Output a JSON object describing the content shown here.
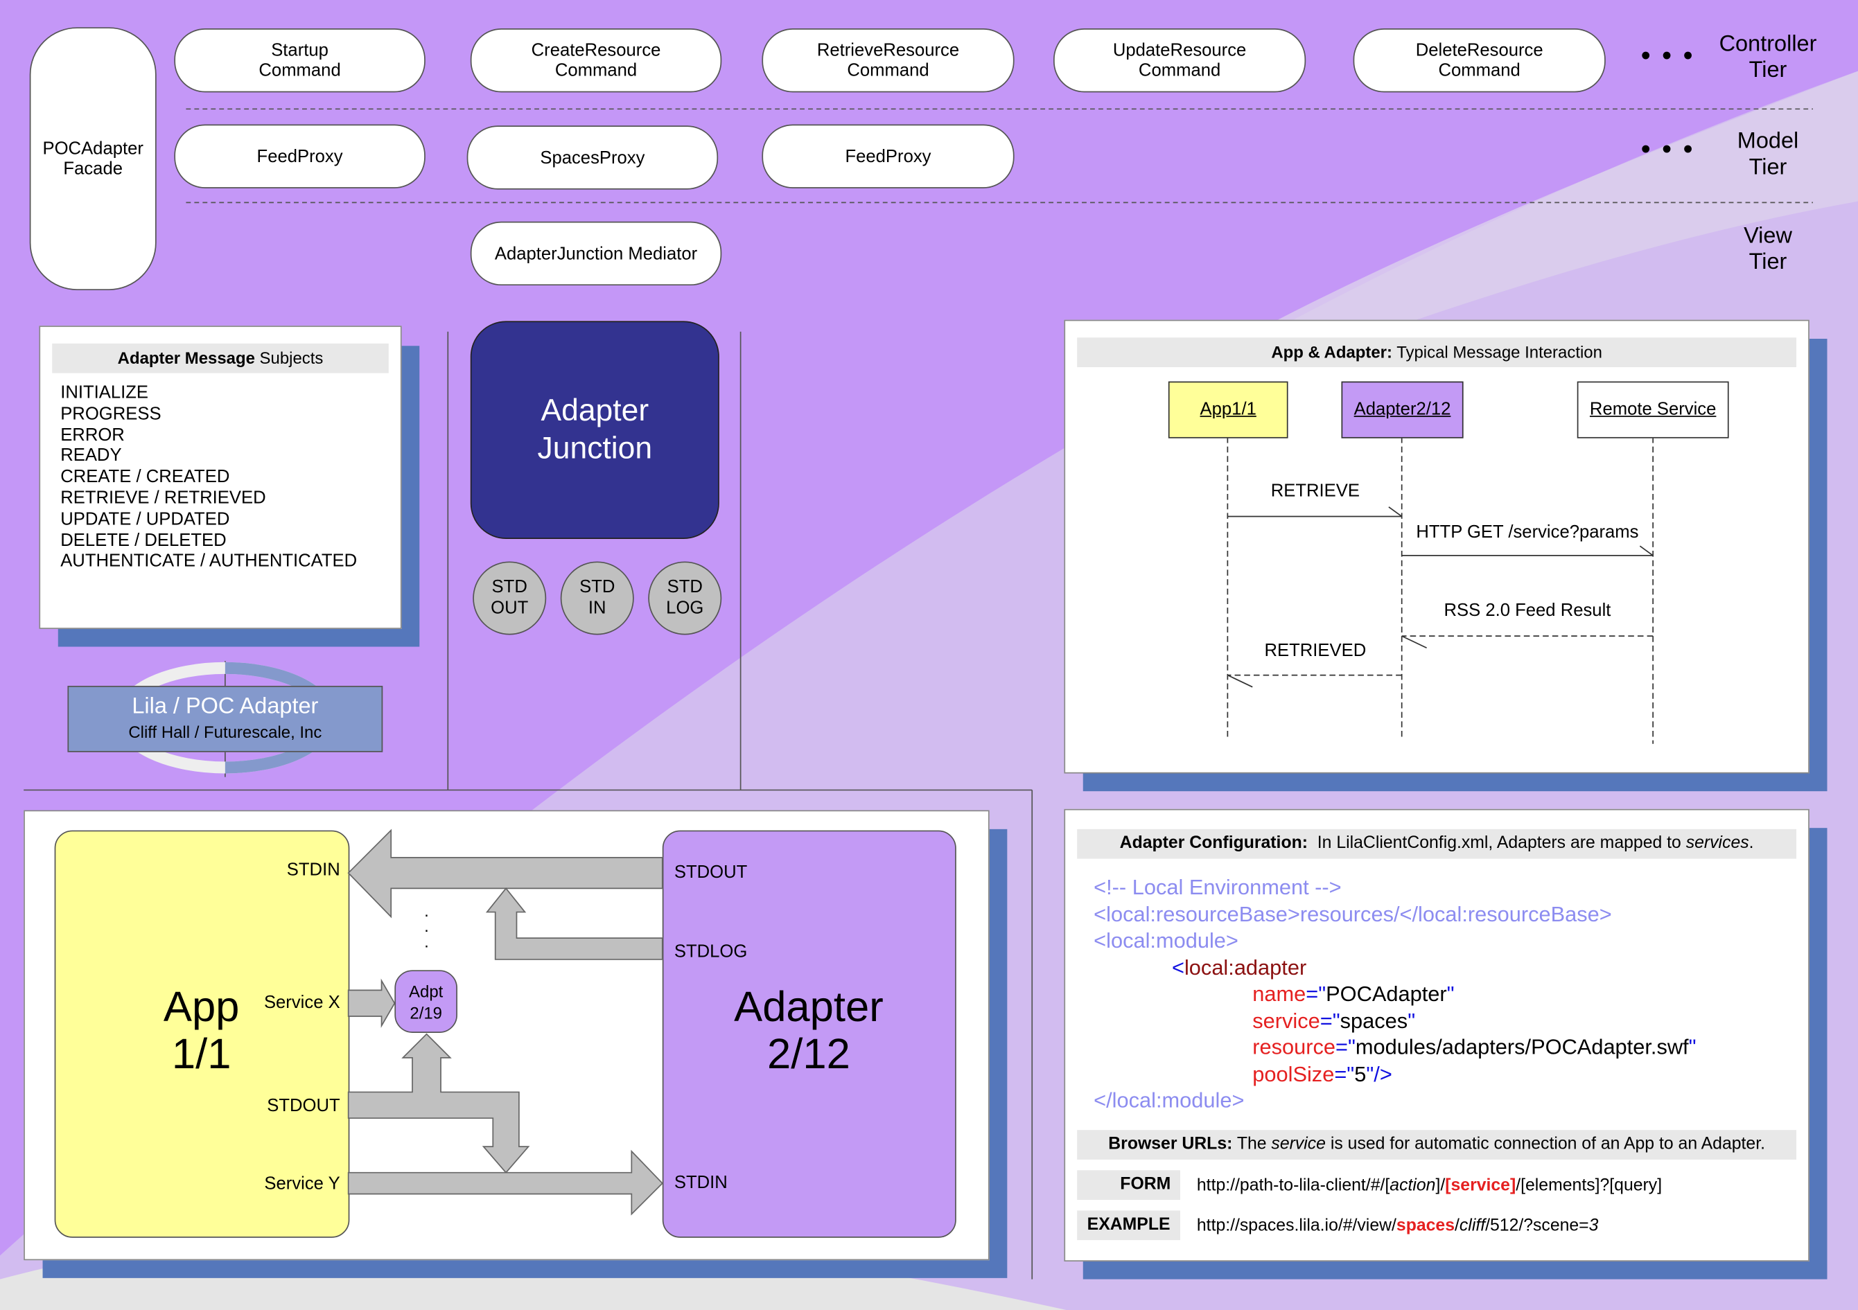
{
  "colors": {
    "background": "#c497f7",
    "junction": "#333390",
    "app": "#ffff99",
    "adapter": "#c39af5",
    "shadow": "#5577bb",
    "logo": "#8499cc"
  },
  "facade": "POCAdapter\nFacade",
  "tiers": {
    "controller": "Controller\nTier",
    "model": "Model\nTier",
    "view": "View\nTier",
    "more": "• • •"
  },
  "controller_commands": [
    "Startup\nCommand",
    "CreateResource\nCommand",
    "RetrieveResource\nCommand",
    "UpdateResource\nCommand",
    "DeleteResource\nCommand"
  ],
  "model_proxies": [
    "FeedProxy",
    "SpacesProxy",
    "FeedProxy"
  ],
  "view_mediators": [
    "AdapterJunction Mediator"
  ],
  "subjects": {
    "title_bold": "Adapter Message",
    "title_rest": " Subjects",
    "items": [
      "INITIALIZE",
      "PROGRESS",
      "ERROR",
      "READY",
      "CREATE / CREATED",
      "RETRIEVE / RETRIEVED",
      "UPDATE / UPDATED",
      "DELETE / DELETED",
      "AUTHENTICATE / AUTHENTICATED"
    ]
  },
  "logo": {
    "title": "Lila / POC Adapter",
    "subtitle": "Cliff Hall / Futurescale, Inc"
  },
  "junction": {
    "title": "Adapter\nJunction",
    "pipes": [
      "STD\nOUT",
      "STD\nIN",
      "STD\nLOG"
    ]
  },
  "sequence": {
    "title_bold": "App & Adapter:",
    "title_rest": " Typical Message Interaction",
    "participants": [
      "App1/1",
      "Adapter2/12",
      "Remote Service"
    ],
    "messages": [
      "RETRIEVE",
      "HTTP GET /service?params",
      "RSS 2.0 Feed Result",
      "RETRIEVED"
    ]
  },
  "pipes_diagram": {
    "app": "App\n1/1",
    "adapter": "Adapter\n2/12",
    "app_ports": [
      "STDIN",
      "Service X",
      "STDOUT",
      "Service Y"
    ],
    "adapter_ports": [
      "STDOUT",
      "STDLOG",
      "STDIN"
    ],
    "mini_adapter": "Adpt\n2/19",
    "ellipsis": "·\n·\n·"
  },
  "config": {
    "title_bold": "Adapter Configuration:",
    "title_rest": "  In LilaClientConfig.xml, Adapters are mapped to ",
    "title_em": "services",
    "title_end": ".",
    "comment": "<!-- Local Environment -->",
    "resource_base": "<local:resourceBase>resources/</local:resourceBase>",
    "module_open": "<local:module>",
    "adapter_lt": "<",
    "adapter_tag": "local:adapter",
    "attrs": [
      {
        "name": "name",
        "value": "POCAdapter"
      },
      {
        "name": "service",
        "value": "spaces"
      },
      {
        "name": "resource",
        "value": "modules/adapters/POCAdapter.swf"
      },
      {
        "name": "poolSize",
        "value": "5"
      }
    ],
    "eq": "=\"",
    "q": "\"",
    "close": "/>",
    "module_close": "</local:module>",
    "urls_bold": "Browser URLs:",
    "urls_rest1": " The ",
    "urls_em": "service",
    "urls_rest2": " is used for automatic connection of an App to an Adapter.",
    "form_label": "FORM",
    "form_a": "http://path-to-lila-client/#/[",
    "form_action": "action",
    "form_b": "]/",
    "form_service": "[service]",
    "form_c": "/[elements]?[query]",
    "example_label": "EXAMPLE",
    "ex_a": "http://spaces.lila.io/#/view/",
    "ex_service": "spaces",
    "ex_b": "/",
    "ex_cliff": "cliff",
    "ex_c": "/512/?scene=",
    "ex_3": "3"
  }
}
